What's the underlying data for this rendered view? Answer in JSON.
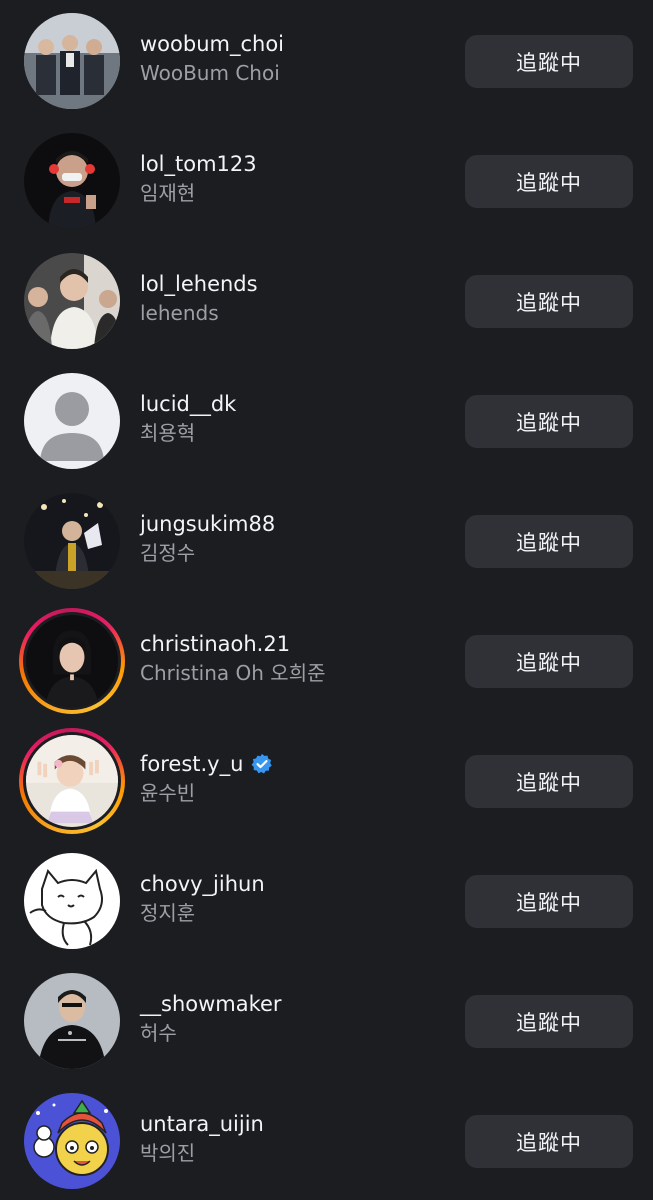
{
  "accounts": [
    {
      "username": "woobum_choi",
      "full_name": "WooBum Choi",
      "button_label": "追蹤中",
      "avatar": "photo-group-suits",
      "story_ring": false,
      "verified": false
    },
    {
      "username": "lol_tom123",
      "full_name": "임재현",
      "button_label": "追蹤中",
      "avatar": "photo-masked-player",
      "story_ring": false,
      "verified": false
    },
    {
      "username": "lol_lehends",
      "full_name": "lehends",
      "button_label": "追蹤中",
      "avatar": "photo-players-seated",
      "story_ring": false,
      "verified": false
    },
    {
      "username": "lucid__dk",
      "full_name": "최용혁",
      "button_label": "追蹤中",
      "avatar": "default-profile-icon",
      "story_ring": false,
      "verified": false
    },
    {
      "username": "jungsukim88",
      "full_name": "김정수",
      "button_label": "追蹤中",
      "avatar": "photo-stage-trophy",
      "story_ring": false,
      "verified": false
    },
    {
      "username": "christinaoh.21",
      "full_name": "Christina Oh 오희준",
      "button_label": "追蹤中",
      "avatar": "photo-woman-portrait",
      "story_ring": true,
      "verified": false
    },
    {
      "username": "forest.y_u",
      "full_name": "윤수빈",
      "button_label": "追蹤中",
      "avatar": "photo-child-peace-sign",
      "story_ring": true,
      "verified": true
    },
    {
      "username": "chovy_jihun",
      "full_name": "정지훈",
      "button_label": "追蹤中",
      "avatar": "drawing-cat-cartoon",
      "story_ring": false,
      "verified": false
    },
    {
      "username": "__showmaker",
      "full_name": "허수",
      "button_label": "追蹤中",
      "avatar": "photo-player-black-shirt",
      "story_ring": false,
      "verified": false
    },
    {
      "username": "untara_uijin",
      "full_name": "박의진",
      "button_label": "追蹤中",
      "avatar": "drawing-cartoon-character",
      "story_ring": false,
      "verified": false
    }
  ],
  "colors": {
    "background": "#1c1d21",
    "button": "#2f3137",
    "text_primary": "#f3f4f6",
    "text_secondary": "#9c9fa6",
    "verified_badge": "#3797f0"
  }
}
